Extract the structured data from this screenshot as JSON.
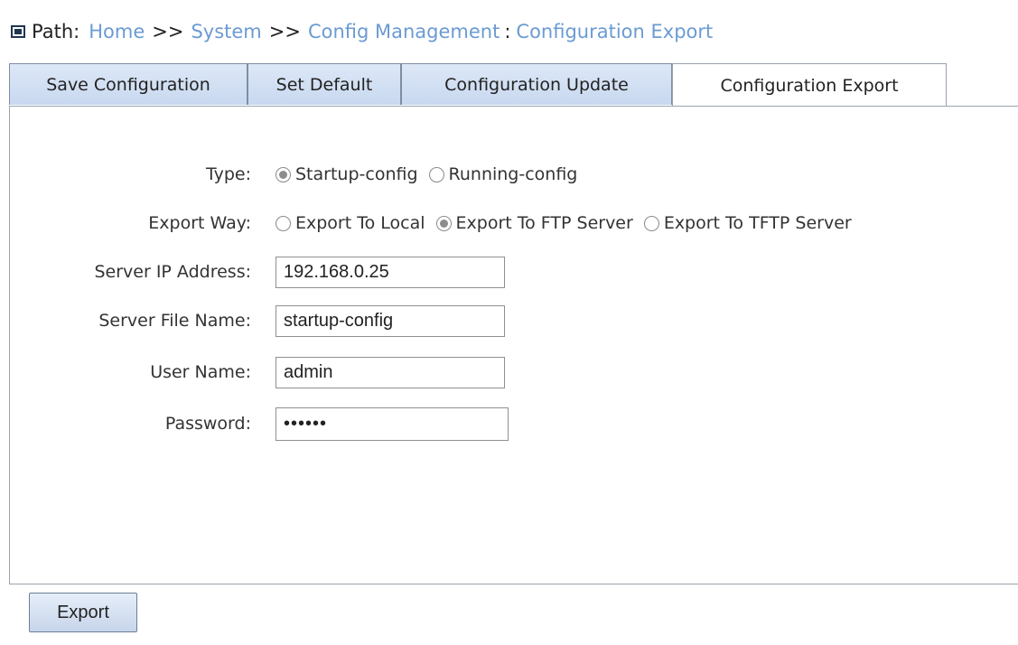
{
  "breadcrumb": {
    "label": "Path:",
    "items": [
      "Home",
      "System",
      "Config Management",
      "Configuration Export"
    ],
    "separator": ">>",
    "last_separator": ":"
  },
  "tabs": [
    {
      "label": "Save Configuration",
      "active": false
    },
    {
      "label": "Set Default",
      "active": false
    },
    {
      "label": "Configuration Update",
      "active": false
    },
    {
      "label": "Configuration Export",
      "active": true
    }
  ],
  "form": {
    "type": {
      "label": "Type:",
      "options": [
        {
          "label": "Startup-config",
          "checked": true
        },
        {
          "label": "Running-config",
          "checked": false
        }
      ]
    },
    "export_way": {
      "label": "Export Way:",
      "options": [
        {
          "label": "Export To Local",
          "checked": false
        },
        {
          "label": "Export To FTP Server",
          "checked": true
        },
        {
          "label": "Export To TFTP Server",
          "checked": false
        }
      ]
    },
    "server_ip": {
      "label": "Server IP Address:",
      "value": "192.168.0.25"
    },
    "server_file": {
      "label": "Server File Name:",
      "value": "startup-config"
    },
    "user_name": {
      "label": "User Name:",
      "value": "admin"
    },
    "password": {
      "label": "Password:",
      "value": "••••••"
    }
  },
  "actions": {
    "export_label": "Export"
  },
  "colors": {
    "link": "#6b9bd3",
    "tab_bg": "#c8d8ef",
    "border": "#9aa3ad"
  }
}
